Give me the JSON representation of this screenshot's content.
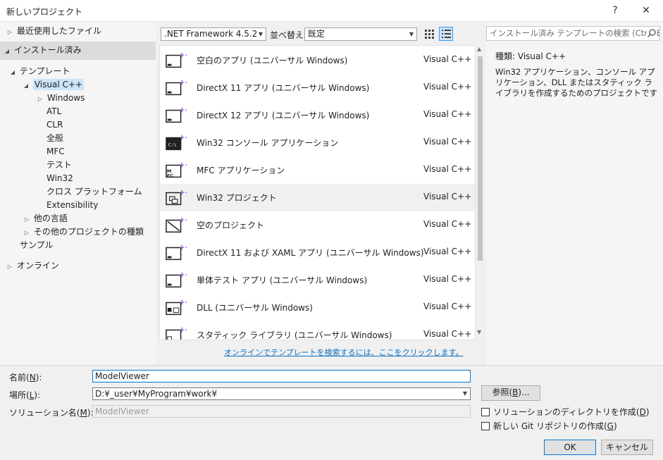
{
  "window": {
    "title": "新しいプロジェクト",
    "help_label": "?",
    "close_label": "✕"
  },
  "tree": {
    "recent": "最近使用したファイル",
    "installed": "インストール済み",
    "templates": "テンプレート",
    "visual_cpp": "Visual C++",
    "windows": "Windows",
    "atl": "ATL",
    "clr": "CLR",
    "general": "全般",
    "mfc": "MFC",
    "test": "テスト",
    "win32": "Win32",
    "cross_platform": "クロス プラットフォーム",
    "extensibility": "Extensibility",
    "other_languages": "他の言語",
    "other_project_types": "その他のプロジェクトの種類",
    "samples": "サンプル",
    "online": "オンライン"
  },
  "toolbar": {
    "framework": ".NET Framework 4.5.2",
    "sort_label": "並べ替え:",
    "sort_value": "既定"
  },
  "search": {
    "placeholder": "インストール済み テンプレートの検索 (Ctrl+E"
  },
  "templates": [
    {
      "name": "空白のアプリ (ユニバーサル Windows)",
      "lang": "Visual C++",
      "icon": "blank-app-icon"
    },
    {
      "name": "DirectX 11 アプリ (ユニバーサル Windows)",
      "lang": "Visual C++",
      "icon": "directx-app-icon"
    },
    {
      "name": "DirectX 12 アプリ (ユニバーサル Windows)",
      "lang": "Visual C++",
      "icon": "directx-app-icon"
    },
    {
      "name": "Win32 コンソール アプリケーション",
      "lang": "Visual C++",
      "icon": "console-app-icon"
    },
    {
      "name": "MFC アプリケーション",
      "lang": "Visual C++",
      "icon": "mfc-app-icon"
    },
    {
      "name": "Win32 プロジェクト",
      "lang": "Visual C++",
      "icon": "win32-project-icon"
    },
    {
      "name": "空のプロジェクト",
      "lang": "Visual C++",
      "icon": "empty-project-icon"
    },
    {
      "name": "DirectX 11 および XAML アプリ (ユニバーサル Windows)",
      "lang": "Visual C++",
      "icon": "directx-xaml-app-icon"
    },
    {
      "name": "単体テスト アプリ (ユニバーサル Windows)",
      "lang": "Visual C++",
      "icon": "unit-test-app-icon"
    },
    {
      "name": "DLL (ユニバーサル Windows)",
      "lang": "Visual C++",
      "icon": "dll-icon"
    },
    {
      "name": "スタティック ライブラリ (ユニバーサル Windows)",
      "lang": "Visual C++",
      "icon": "static-library-icon"
    }
  ],
  "online_link": "オンラインでテンプレートを検索するには、ここをクリックします。",
  "description": {
    "type_label": "種類:",
    "type_value": "Visual C++",
    "text": "Win32 アプリケーション、コンソール アプリケーション、DLL またはスタティック ライブラリを作成するためのプロジェクトです"
  },
  "form": {
    "name_label": "名前(",
    "name_key": "N",
    "location_label": "場所(",
    "location_key": "L",
    "solution_label": "ソリューション名(",
    "solution_key": "M",
    "label_suffix": "):",
    "name_value": "ModelViewer",
    "location_value": "D:¥_user¥MyProgram¥work¥",
    "solution_value": "ModelViewer",
    "browse_label": "参照(",
    "browse_key": "B",
    "browse_suffix": ")...",
    "create_dir_label": "ソリューションのディレクトリを作成(",
    "create_dir_key": "D",
    "git_label": "新しい Git リポジトリの作成(",
    "git_key": "G",
    "close_paren": ")",
    "ok": "OK",
    "cancel": "キャンセル"
  },
  "colors": {
    "accent": "#0078d7",
    "selection": "#cce4f7",
    "link": "#0e70c0",
    "icon_purple": "#8a52c7"
  }
}
